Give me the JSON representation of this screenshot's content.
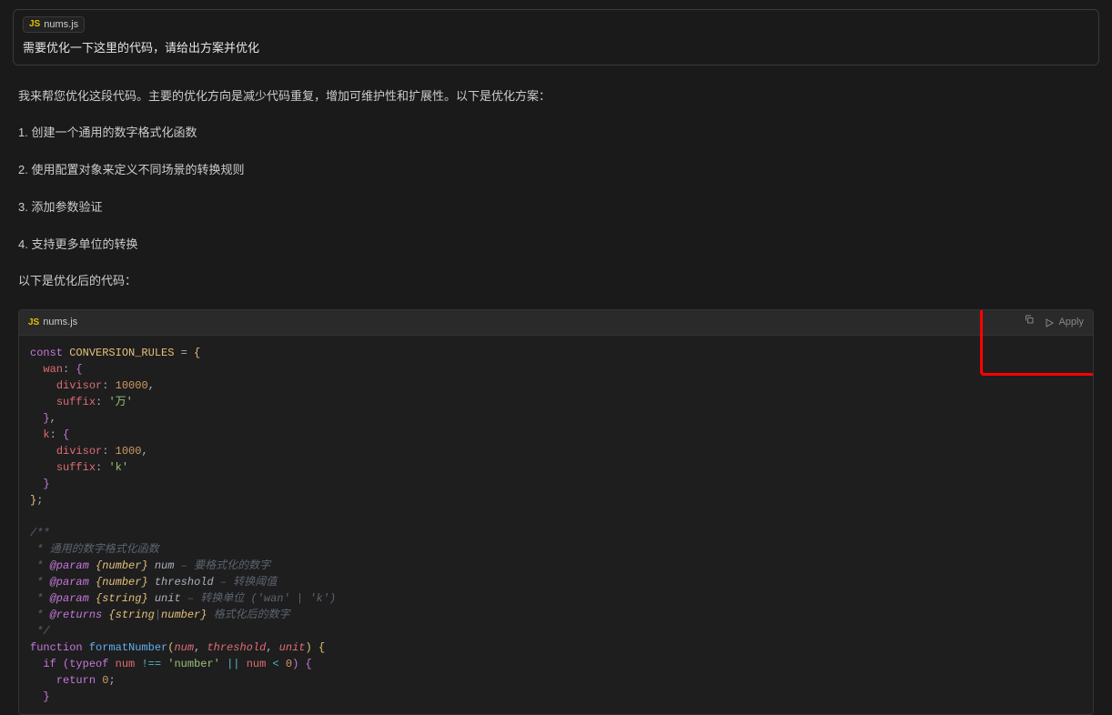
{
  "input": {
    "file_chip": {
      "icon_label": "JS",
      "filename": "nums.js"
    },
    "text": "需要优化一下这里的代码，请给出方案并优化"
  },
  "response": {
    "intro": "我来帮您优化这段代码。主要的优化方向是减少代码重复，增加可维护性和扩展性。以下是优化方案：",
    "point1": "1. 创建一个通用的数字格式化函数",
    "point2": "2. 使用配置对象来定义不同场景的转换规则",
    "point3": "3. 添加参数验证",
    "point4": "4. 支持更多单位的转换",
    "outro": "以下是优化后的代码：",
    "code_chip": {
      "icon_label": "JS",
      "filename": "nums.js"
    },
    "apply_label": "Apply"
  },
  "code": {
    "kw_const": "const",
    "const_name": "CONVERSION_RULES",
    "eq": " = ",
    "lbrace": "{",
    "rbrace": "}",
    "semi": ";",
    "comma": ",",
    "colon": ":",
    "wan": "wan",
    "k": "k",
    "divisor": "divisor",
    "suffix": "suffix",
    "n10000": "10000",
    "n1000": "1000",
    "str_wan": "'万'",
    "str_k": "'k'",
    "doc_open": "/**",
    "doc_line1": " * 通用的数字格式化函数",
    "doc_param": "@param",
    "doc_returns": "@returns",
    "doc_num_t": "{number}",
    "doc_str_t": "{string}",
    "doc_ret_t": "{string|number}",
    "doc_v_num": "num",
    "doc_v_thr": "threshold",
    "doc_v_unit": "unit",
    "doc_d_num": " – 要格式化的数字",
    "doc_d_thr": " – 转换阈值",
    "doc_d_unit": " – 转换单位 ('wan' | 'k')",
    "doc_d_ret": " 格式化后的数字",
    "doc_close": " */",
    "doc_star": " * ",
    "kw_function": "function",
    "fn_name": "formatNumber",
    "lparen": "(",
    "rparen": ")",
    "p_num": "num",
    "p_thr": "threshold",
    "p_unit": "unit",
    "kw_if": "if",
    "kw_typeof": "typeof",
    "kw_return": "return",
    "op_neq": "!==",
    "op_or": "||",
    "op_lt": "<",
    "str_number": "'number'",
    "n0": "0",
    "sp": " "
  }
}
